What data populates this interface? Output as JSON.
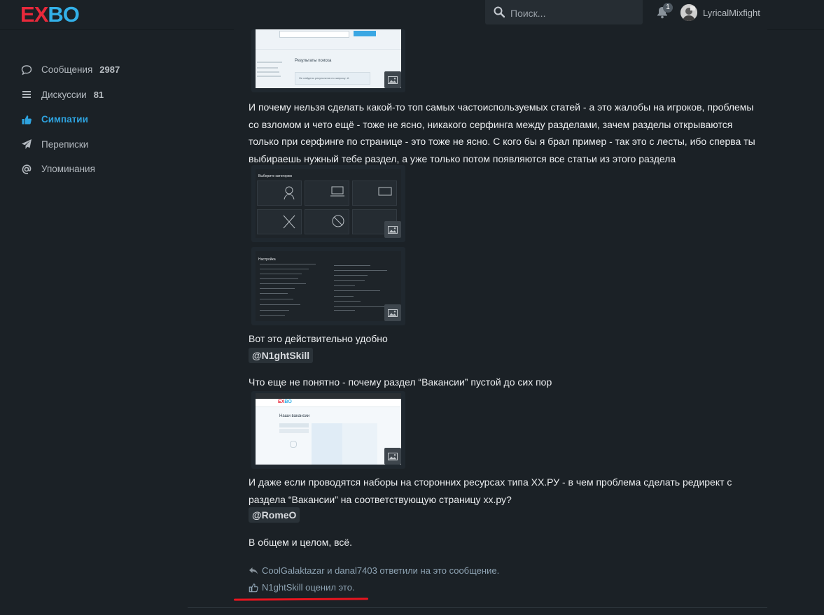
{
  "header": {
    "logo": {
      "left": "E",
      "mid": "X",
      "right": "BO"
    },
    "search_placeholder": "Поиск...",
    "notification_count": "1",
    "username": "LyricalMixfight"
  },
  "sidebar": {
    "items": [
      {
        "label": "Сообщения",
        "count": "2987",
        "icon": "chat-bubble-icon"
      },
      {
        "label": "Дискуссии",
        "count": "81",
        "icon": "list-icon"
      },
      {
        "label": "Симпатии",
        "count": "",
        "icon": "thumbs-up-icon",
        "active": true
      },
      {
        "label": "Переписки",
        "count": "",
        "icon": "paper-plane-icon"
      },
      {
        "label": "Упоминания",
        "count": "",
        "icon": "at-icon"
      }
    ]
  },
  "post": {
    "para1": "И почему нельзя сделать какой-то топ самых частоиспользуемых статей - а это жалобы на игроков, проблемы со взломом и чето ещё - тоже не ясно, никакого серфинга между разделами, зачем разделы открываются только при серфинге по странице - это тоже не ясно. С кого бы я брал пример - так это с лесты, ибо сперва ты выбираешь нужный тебе раздел, а уже только потом появляются все статьи из этого раздела",
    "para2": "Вот это действительно удобно",
    "mention1": "@N1ghtSkill",
    "para3": "Что еще не понятно - почему раздел “Вакансии” пустой до сих пор",
    "para4": "И даже если проводятся наборы на сторонних ресурсах типа XX.РУ - в чем проблема сделать редирект с раздела “Вакансии” на соответствующую страницу xx.ру?",
    "mention2": "@RomeO",
    "para5": "В общем и целом, всё.",
    "replies": "CoolGalaktazar и danal7403 ответили на это сообщение.",
    "likes": "N1ghtSkill оценил это."
  },
  "thumbs": {
    "search_title": "Результаты поиска",
    "search_note": "Не найдено результатов по запросу: А",
    "categories_title": "Выберите категорию",
    "settings_title": "Настройка",
    "vacancies_title": "Наши вакансии"
  }
}
